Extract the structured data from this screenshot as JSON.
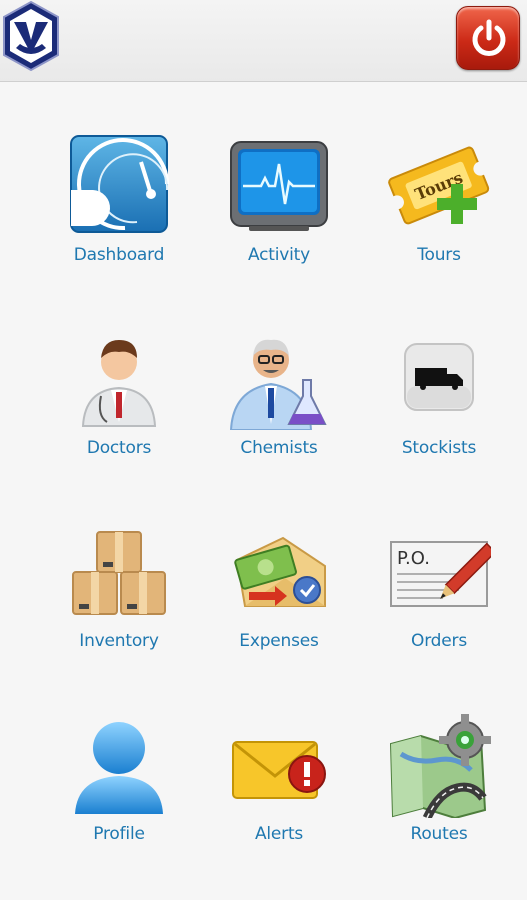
{
  "header": {
    "logo_icon": "company-shield-logo",
    "power_icon": "power-icon",
    "power_color": "#d7301f"
  },
  "menu": {
    "label_color": "#1f78b0",
    "items": [
      {
        "label": "Dashboard",
        "icon": "speedometer-icon"
      },
      {
        "label": "Activity",
        "icon": "heart-monitor-icon"
      },
      {
        "label": "Tours",
        "icon": "tour-ticket-icon"
      },
      {
        "label": "Doctors",
        "icon": "doctor-icon"
      },
      {
        "label": "Chemists",
        "icon": "chemist-icon"
      },
      {
        "label": "Stockists",
        "icon": "truck-icon"
      },
      {
        "label": "Inventory",
        "icon": "boxes-icon"
      },
      {
        "label": "Expenses",
        "icon": "money-envelope-icon"
      },
      {
        "label": "Orders",
        "icon": "purchase-order-icon"
      },
      {
        "label": "Profile",
        "icon": "user-icon"
      },
      {
        "label": "Alerts",
        "icon": "mail-alert-icon"
      },
      {
        "label": "Routes",
        "icon": "map-gear-icon"
      }
    ]
  }
}
